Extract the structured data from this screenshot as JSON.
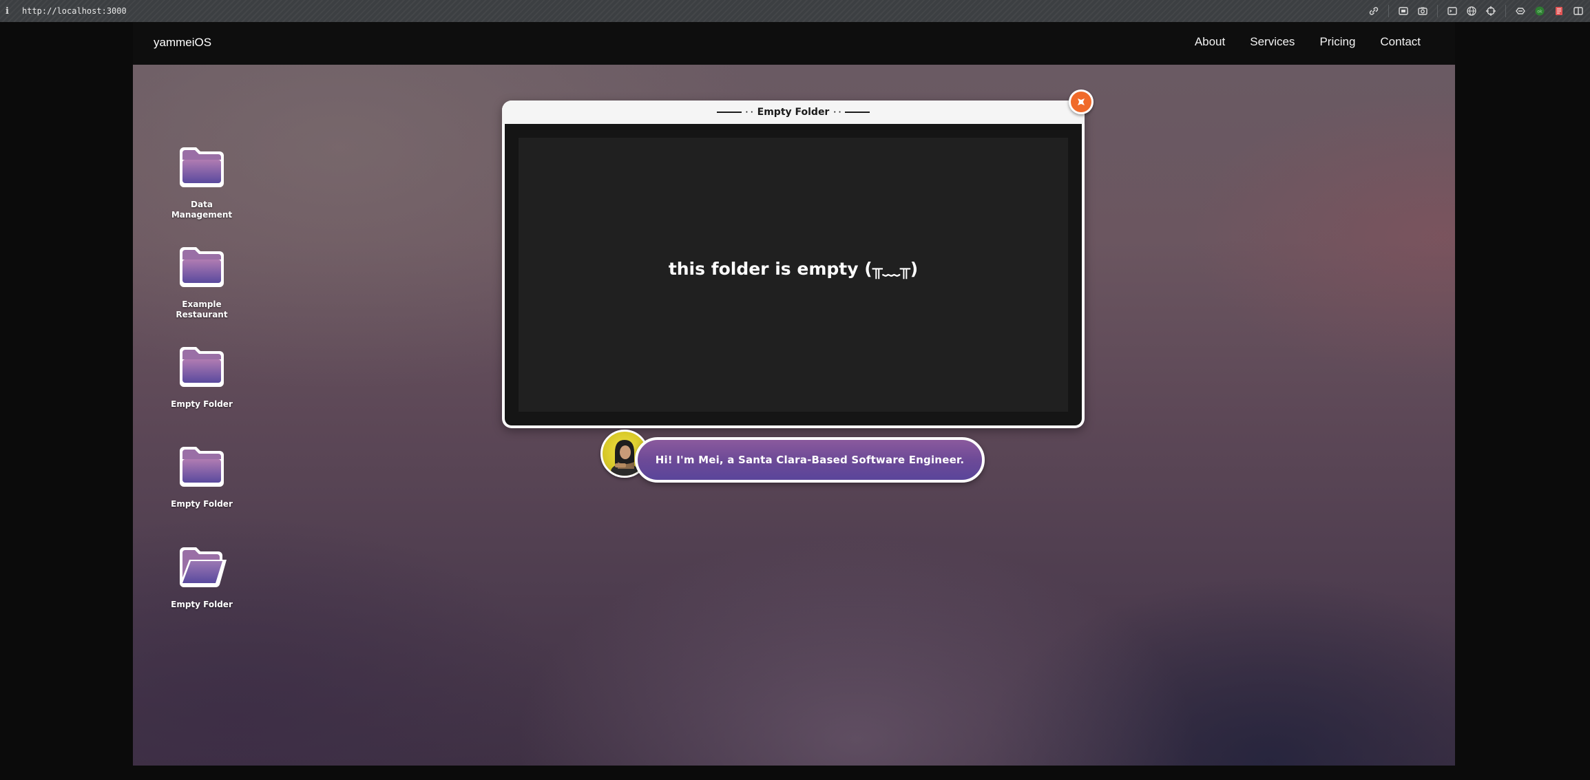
{
  "browser": {
    "info_glyph": "i",
    "url": "http://localhost:3000",
    "toolbar_icons": [
      "link-icon",
      "screen-capture-icon",
      "camera-icon",
      "terminal-icon",
      "globe-icon",
      "crosshair-icon",
      "extensions-icon",
      "status-dot-icon",
      "reader-icon",
      "sidebar-icon"
    ]
  },
  "navbar": {
    "brand": "yammeiOS",
    "links": [
      "About",
      "Services",
      "Pricing",
      "Contact"
    ]
  },
  "desktop": {
    "icons": [
      {
        "label": "Data Management",
        "state": "closed"
      },
      {
        "label": "Example Restaurant",
        "state": "closed"
      },
      {
        "label": "Empty Folder",
        "state": "closed"
      },
      {
        "label": "Empty Folder",
        "state": "closed"
      },
      {
        "label": "Empty Folder",
        "state": "open"
      }
    ]
  },
  "window": {
    "title": "Empty Folder",
    "title_dots_left": "· ·",
    "title_dots_right": "· ·",
    "message": "this folder is empty (╥﹏╥)",
    "close_icon": "close-icon"
  },
  "speech": {
    "text": "Hi! I'm Mei, a Santa Clara-Based Software Engineer."
  },
  "colors": {
    "folder_top": "#a57ab0",
    "folder_bottom": "#5a4a9e",
    "close": "#f06a2a",
    "bubble": "#6d4a97"
  }
}
